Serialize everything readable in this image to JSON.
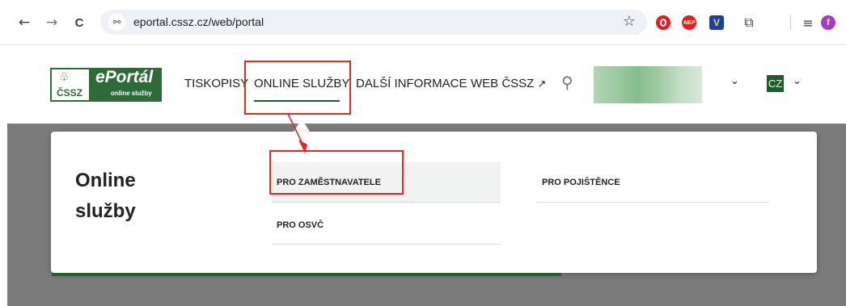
{
  "browser": {
    "back_icon": "←",
    "forward_icon": "→",
    "reload_icon": "C",
    "url": "eportal.cssz.cz/web/portal",
    "tune_icon": "⚯",
    "bookmark_icon": "☆",
    "extensions": [
      {
        "name": "opera-extension",
        "color": "#e51d1d",
        "label": ""
      },
      {
        "name": "adblock-plus-extension",
        "color": "#e51d1d",
        "label": "ABP"
      },
      {
        "name": "checkmark-extension",
        "color": "#1a3fa6",
        "label": "V"
      }
    ],
    "puzzle_icon": "⧉",
    "reading_list_icon": "≡",
    "profile_letter": "f",
    "profile_color": "#a53cc1"
  },
  "site": {
    "logo": {
      "leaf": "♧",
      "cssz": "ČSSZ",
      "eportal": "ePortál",
      "subtitle": "online služby"
    },
    "nav": [
      {
        "label": "TISKOPISY"
      },
      {
        "label": "ONLINE SLUŽBY"
      },
      {
        "label": "DALŠÍ INFORMACE"
      },
      {
        "label": "WEB ČSSZ",
        "ext_icon": "↗"
      }
    ],
    "search_icon": "⚲",
    "user_chevron": "⌄",
    "lang": "CZ",
    "lang_chevron": "⌄",
    "brand_color": "#2e6b39"
  },
  "dropdown": {
    "title": "Online služby",
    "items": [
      {
        "label": "PRO ZAMĚSTNAVATELE"
      },
      {
        "label": "PRO POJIŠTĚNCE"
      },
      {
        "label": "PRO OSVČ"
      }
    ]
  },
  "annotation_color": "#e02a2a"
}
